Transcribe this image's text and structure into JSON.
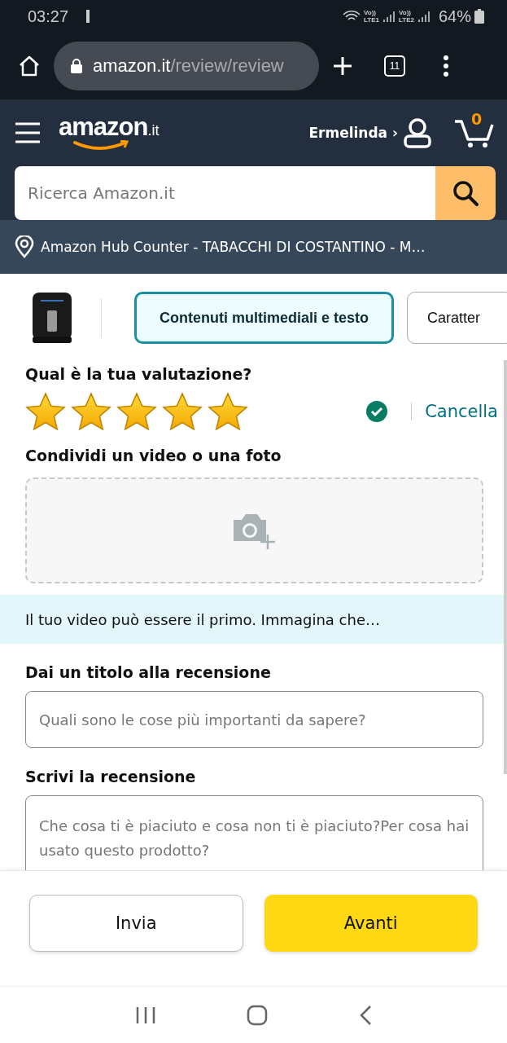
{
  "status_bar": {
    "time": "03:27",
    "sim1": "LTE1",
    "sim2": "LTE2",
    "volte1": "Vo))",
    "volte2": "Vo))",
    "battery": "64%"
  },
  "browser": {
    "url_host": "amazon.it",
    "url_path": "/review/review",
    "tab_count": "11"
  },
  "header": {
    "logo": "amazon",
    "logo_suffix": ".it",
    "account": "Ermelinda ›",
    "cart_count": "0"
  },
  "search": {
    "placeholder": "Ricerca Amazon.it"
  },
  "location": "Amazon Hub Counter - TABACCHI DI COSTANTINO - M…",
  "tabs": [
    {
      "label": "Contenuti multimediali e testo",
      "selected": true
    },
    {
      "label": "Caratter",
      "selected": false
    }
  ],
  "rating": {
    "heading": "Qual è la tua valutazione?",
    "stars": 5,
    "confirmed": true,
    "clear": "Cancella"
  },
  "media": {
    "heading": "Condividi un video o una foto"
  },
  "banner": "Il tuo video può essere il primo. Immagina che…",
  "title_field": {
    "label": "Dai un titolo alla recensione",
    "placeholder": "Quali sono le cose più importanti da sapere?"
  },
  "review_field": {
    "label": "Scrivi la recensione",
    "placeholder": "Che cosa ti è piaciuto e cosa non ti è piaciuto?Per cosa hai usato questo prodotto?"
  },
  "buttons": [
    {
      "label": "Invia",
      "kind": "secondary"
    },
    {
      "label": "Avanti",
      "kind": "primary"
    }
  ]
}
